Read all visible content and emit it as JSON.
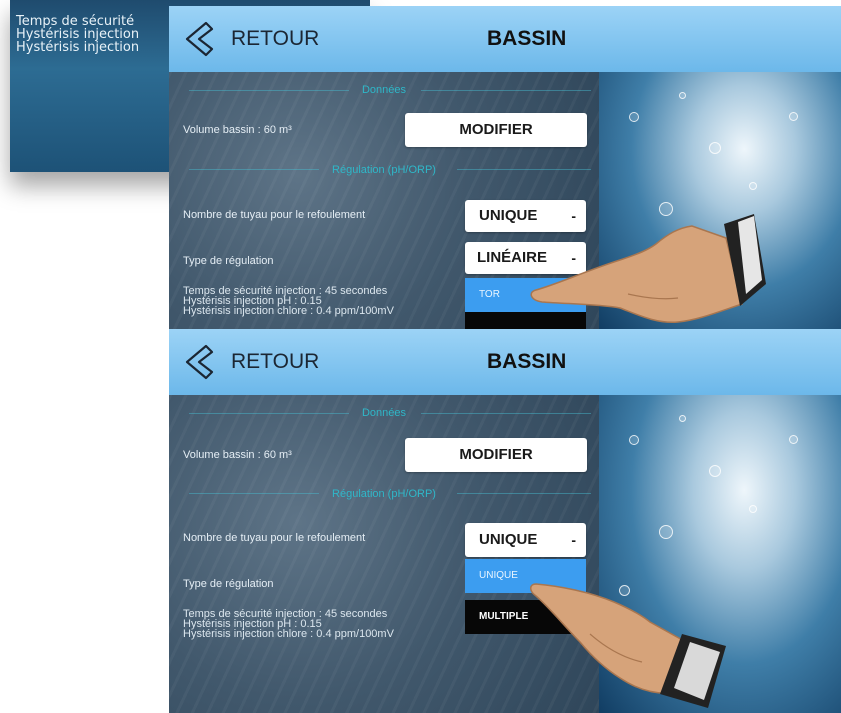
{
  "background_screen": {
    "lines": [
      "Temps de sécurité",
      "Hystérisis injection",
      "Hystérisis injection"
    ]
  },
  "screens": [
    {
      "header": {
        "back_label": "RETOUR",
        "title": "BASSIN"
      },
      "sections": {
        "donnees": "Données",
        "regulation": "Régulation (pH/ORP)"
      },
      "volume_label": "Volume bassin : 60 m³",
      "modifier_label": "MODIFIER",
      "tuyau_label": "Nombre de tuyau pour le refoulement",
      "tuyau_value": "UNIQUE",
      "regulation_label": "Type de régulation",
      "regulation_value": "LINÉAIRE",
      "caret": "-",
      "info": [
        "Temps de sécurité injection : 45 secondes",
        "Hystérisis injection pH : 0.15",
        "Hystérisis injection chlore : 0.4 ppm/100mV"
      ],
      "dropdown_options": [
        "TOR"
      ]
    },
    {
      "header": {
        "back_label": "RETOUR",
        "title": "BASSIN"
      },
      "sections": {
        "donnees": "Données",
        "regulation": "Régulation (pH/ORP)"
      },
      "volume_label": "Volume bassin : 60 m³",
      "modifier_label": "MODIFIER",
      "tuyau_label": "Nombre de tuyau pour le refoulement",
      "tuyau_value": "UNIQUE",
      "regulation_label": "Type de régulation",
      "caret": "-",
      "info": [
        "Temps de sécurité injection : 45 secondes",
        "Hystérisis injection pH : 0.15",
        "Hystérisis injection chlore : 0.4 ppm/100mV"
      ],
      "dropdown_options": [
        "UNIQUE",
        "MULTIPLE"
      ]
    }
  ],
  "colors": {
    "header_top": "#9cd3f6",
    "header_bottom": "#6cb8ea",
    "section_title": "#2fb7c8",
    "selected_option": "#3c9df0",
    "unselected_option": "#070707"
  },
  "icons": [
    "back-chevron-icon",
    "hand-pointer"
  ]
}
